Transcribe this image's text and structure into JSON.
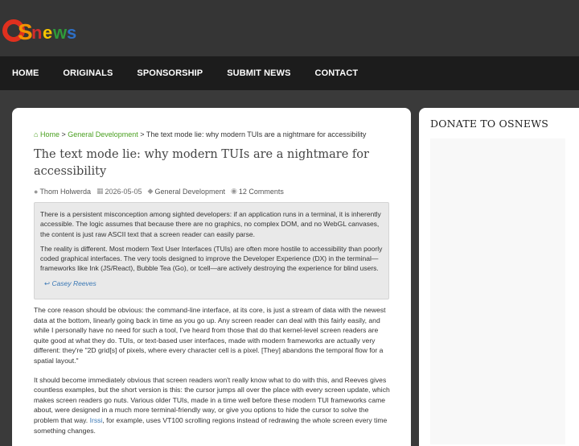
{
  "logo": {
    "text_o": "O",
    "text_s": "S",
    "text_news": "news"
  },
  "nav": [
    {
      "label": "HOME"
    },
    {
      "label": "ORIGINALS"
    },
    {
      "label": "SPONSORSHIP"
    },
    {
      "label": "SUBMIT NEWS"
    },
    {
      "label": "CONTACT"
    }
  ],
  "breadcrumb": {
    "home": "Home",
    "sep1": " > ",
    "category": "General Development",
    "sep2": " > ",
    "current": "The text mode lie: why modern TUIs are a nightmare for accessibility"
  },
  "article": {
    "title": "The text mode lie: why modern TUIs are a nightmare for accessibility",
    "author": "Thom Holwerda",
    "date": "2026-05-05",
    "category": "General Development",
    "comments": "12 Comments",
    "quote_p1": "There is a persistent misconception among sighted developers: if an application runs in a terminal, it is inherently accessible. The logic assumes that because there are no graphics, no complex DOM, and no WebGL canvases, the content is just raw ASCII text that a screen reader can easily parse.",
    "quote_p2": "The reality is different. Most modern Text User Interfaces (TUIs) are often more hostile to accessibility than poorly coded graphical interfaces. The very tools designed to improve the Developer Experience (DX) in the terminal—frameworks like Ink (JS/React), Bubble Tea (Go), or tcell—are actively destroying the experience for blind users.",
    "quote_cite": "Casey Reeves",
    "body_p1": "The core reason should be obvious: the command-line interface, at its core, is just a stream of data with the newest data at the bottom, linearly going back in time as you go up. Any screen reader can deal with this fairly easily, and while I personally have no need for such a tool, I've heard from those that do that kernel-level screen readers are quite good at what they do. TUIs, or text-based user interfaces, made with modern frameworks are actually very different: they're \"2D grid[s] of pixels, where every character cell is a pixel. [They] abandons the temporal flow for a spatial layout.\"",
    "body_p2_a": "It should become immediately obvious that screen readers won't really know what to do with this, and Reeves gives countless examples, but the short version is this: the cursor jumps all over the place with every screen update, which makes screen readers go nuts. Various older TUIs, made in a time well before these modern TUI frameworks came about, were designed in a much more terminal-friendly way, or give you options to hide the cursor to solve the problem that way. ",
    "body_p2_link": "Irssi",
    "body_p2_b": ", for example, uses VT100 scrolling regions instead of redrawing the whole screen every time something changes."
  },
  "sidebar": {
    "title": "DONATE TO OSNEWS"
  },
  "colors": {
    "header_bg": "#353535",
    "nav_bg": "#1c1c1c",
    "page_bg": "#3a3a3a",
    "link_green": "#4aa020",
    "link_blue": "#3a78b5",
    "quote_bg": "#e9e9e9"
  },
  "icons": {
    "home": "home-icon",
    "author": "user-icon",
    "date": "calendar-icon",
    "category": "tag-icon",
    "comments": "comments-icon",
    "cite": "reply-arrow-icon"
  }
}
